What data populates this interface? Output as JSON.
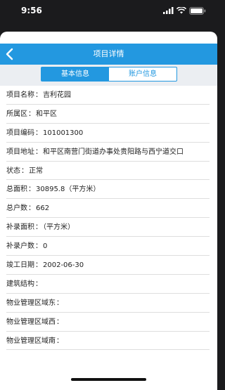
{
  "status_bar": {
    "time": "9:56"
  },
  "nav": {
    "title": "项目详情"
  },
  "tabs": [
    {
      "label": "基本信息",
      "active": true
    },
    {
      "label": "账户信息",
      "active": false
    }
  ],
  "rows": [
    {
      "label": "项目名称",
      "value": "吉利花园"
    },
    {
      "label": "所属区",
      "value": "和平区"
    },
    {
      "label": "项目编码",
      "value": "101001300"
    },
    {
      "label": "项目地址",
      "value": "和平区南营门街道办事处贵阳路与西宁道交口"
    },
    {
      "label": "状态",
      "value": "正常"
    },
    {
      "label": "总面积",
      "value": "30895.8（平方米）"
    },
    {
      "label": "总户数",
      "value": "662"
    },
    {
      "label": "补录面积",
      "value": "（平方米）"
    },
    {
      "label": "补录户数",
      "value": "0"
    },
    {
      "label": "竣工日期",
      "value": "2002-06-30"
    },
    {
      "label": "建筑结构",
      "value": ""
    },
    {
      "label": "物业管理区域东",
      "value": ""
    },
    {
      "label": "物业管理区域西",
      "value": ""
    },
    {
      "label": "物业管理区域南",
      "value": ""
    }
  ],
  "colors": {
    "accent": "#2398e0",
    "tab_background": "#ebeef2"
  }
}
